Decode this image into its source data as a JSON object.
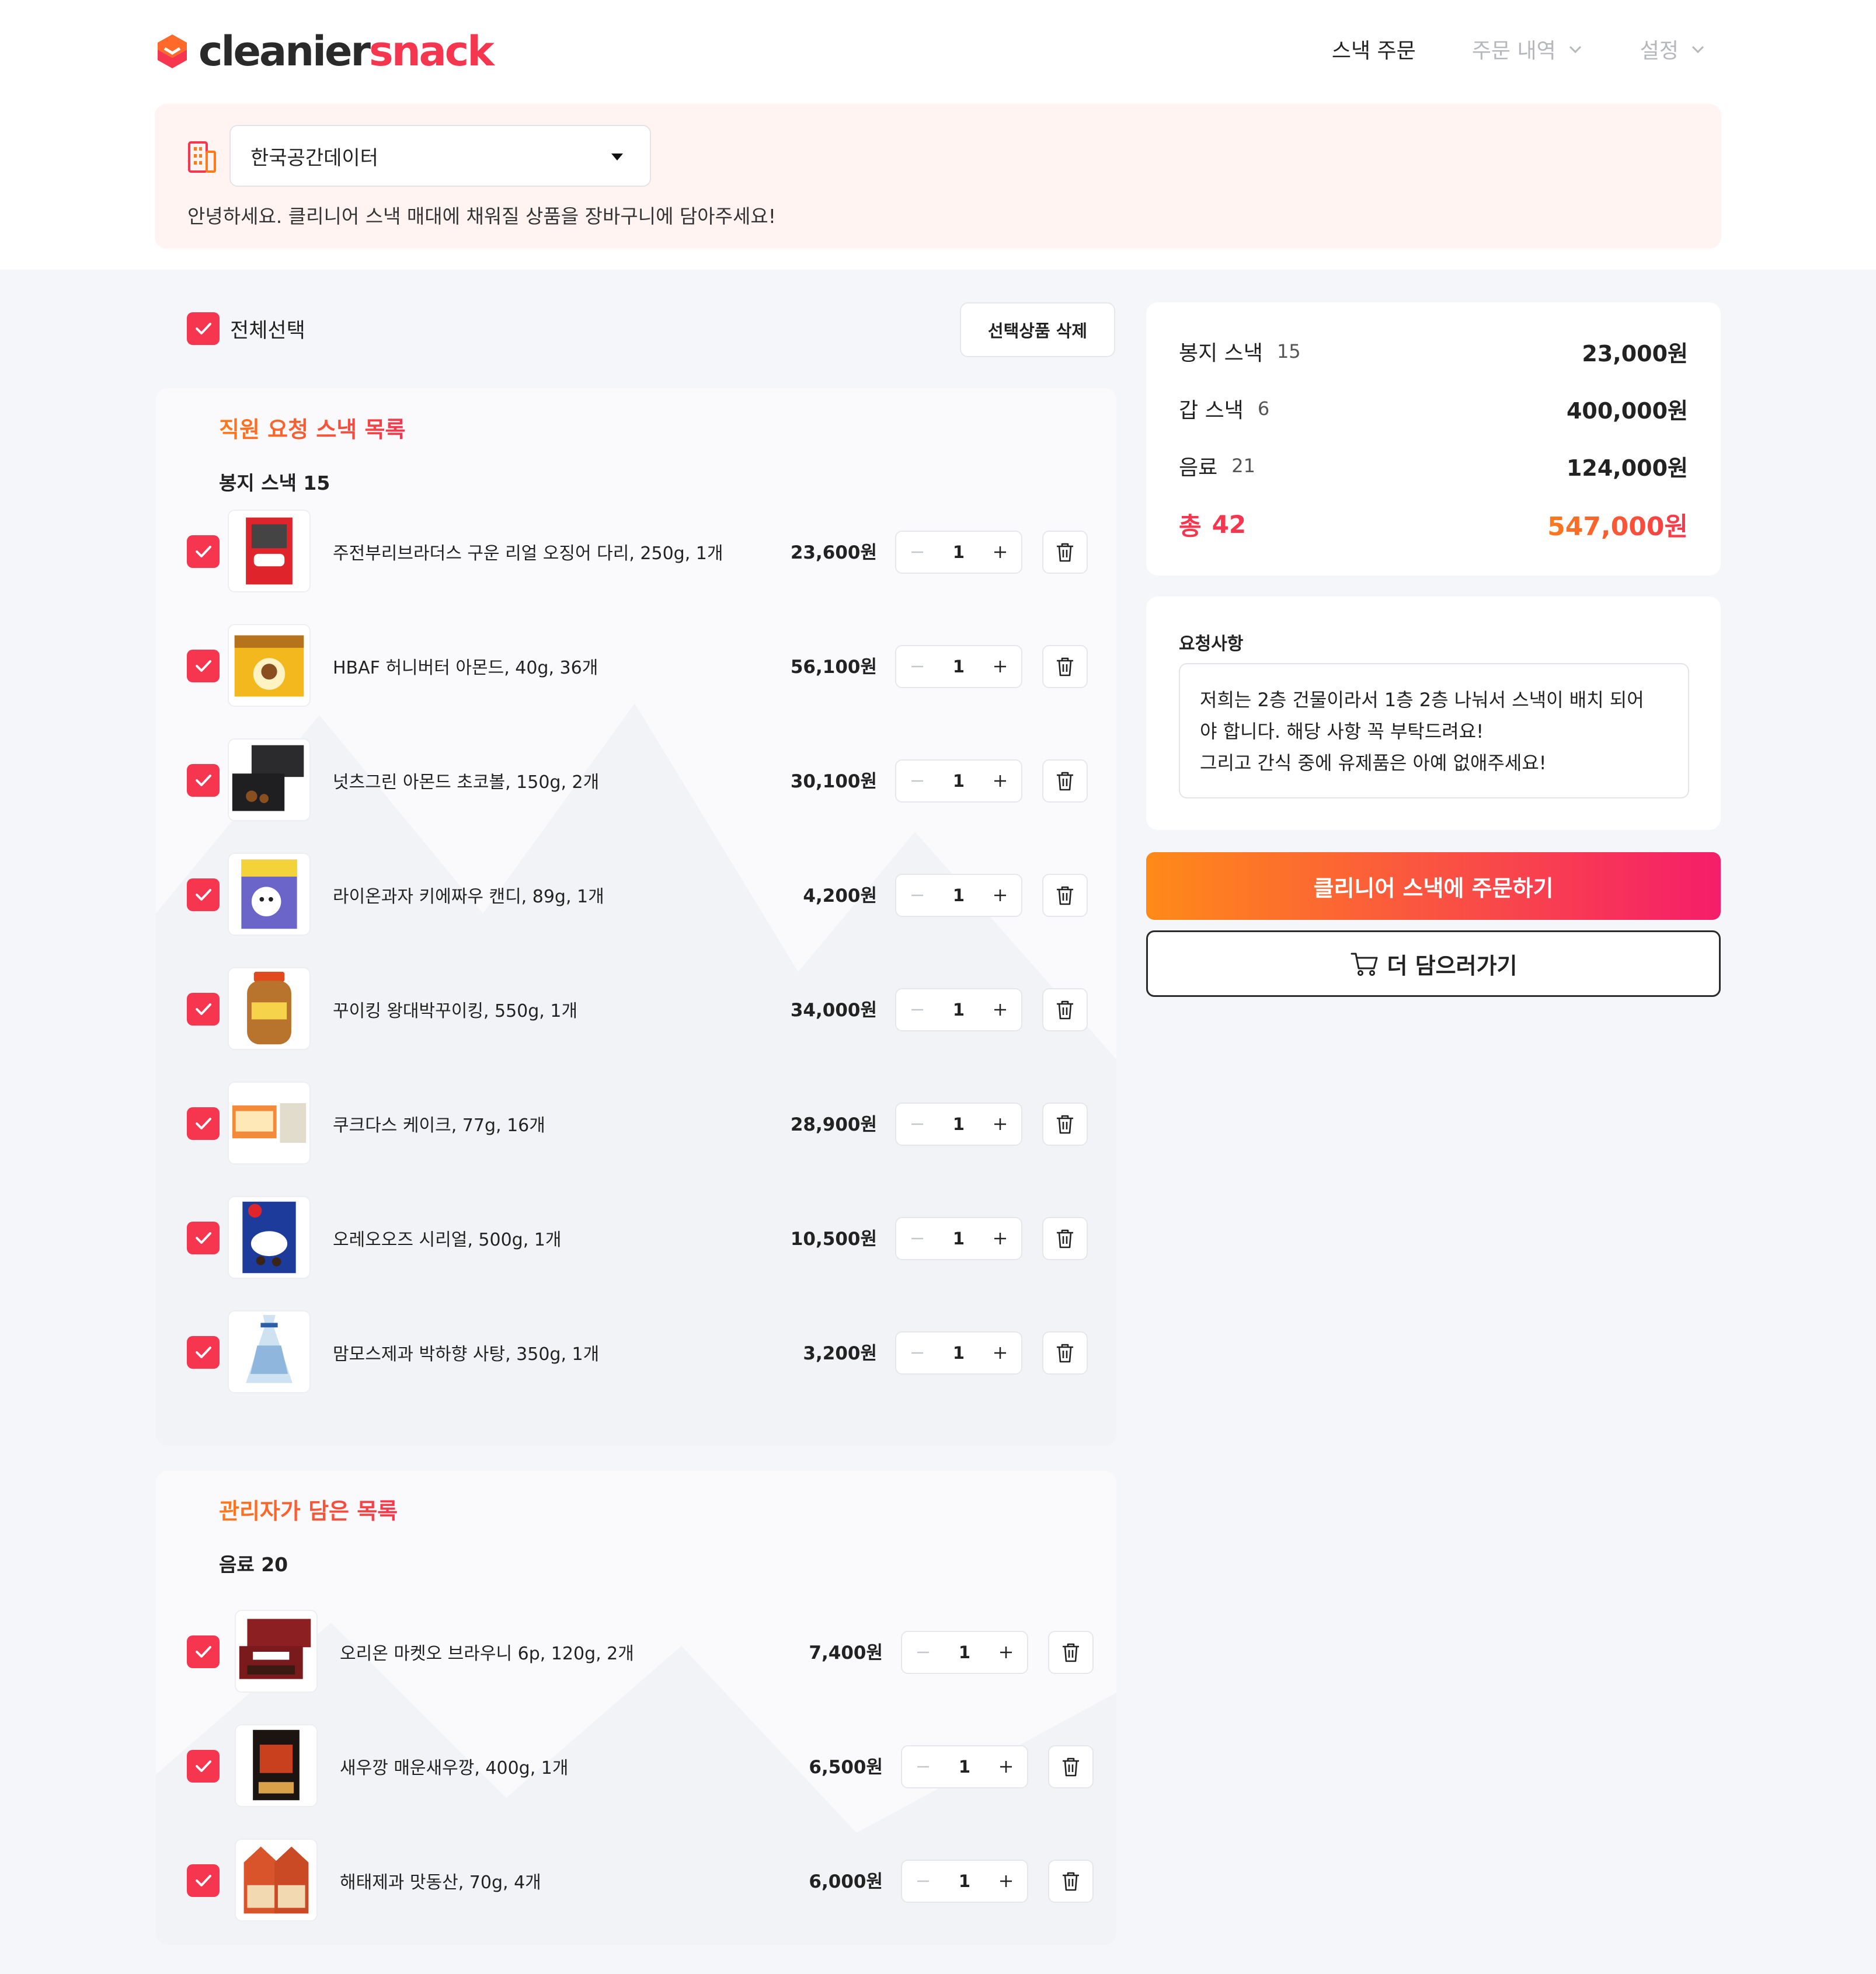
{
  "brand": {
    "part1": "cleanier",
    "part2": "snack"
  },
  "nav": [
    {
      "label": "스낵 주문",
      "active": true,
      "dropdown": false
    },
    {
      "label": "주문 내역",
      "active": false,
      "dropdown": true
    },
    {
      "label": "설정",
      "active": false,
      "dropdown": true
    }
  ],
  "banner": {
    "company": "한국공간데이터",
    "greeting": "안녕하세요. 클리니어 스낵 매대에 채워질 상품을 장바구니에 담아주세요!"
  },
  "list": {
    "select_all_label": "전체선택",
    "delete_selected_label": "선택상품 삭제"
  },
  "sections": [
    {
      "title": "직원 요청 스낵 목록",
      "group": "봉지 스낵 15",
      "items": [
        {
          "name": "주전부리브라더스 구운 리얼 오징어 다리, 250g, 1개",
          "price": "23,600원",
          "qty": "1",
          "icon": "squid-snack"
        },
        {
          "name": "HBAF 허니버터 아몬드, 40g, 36개",
          "price": "56,100원",
          "qty": "1",
          "icon": "almond-pack"
        },
        {
          "name": "넛츠그린 아몬드 초코볼, 150g, 2개",
          "price": "30,100원",
          "qty": "1",
          "icon": "choco-box"
        },
        {
          "name": "라이온과자 키에짜우 캔디, 89g, 1개",
          "price": "4,200원",
          "qty": "1",
          "icon": "candy-bag"
        },
        {
          "name": "꾸이킹 왕대박꾸이킹, 550g, 1개",
          "price": "34,000원",
          "qty": "1",
          "icon": "jar-snack"
        },
        {
          "name": "쿠크다스 케이크, 77g, 16개",
          "price": "28,900원",
          "qty": "1",
          "icon": "cake-box"
        },
        {
          "name": "오레오오즈 시리얼, 500g, 1개",
          "price": "10,500원",
          "qty": "1",
          "icon": "cereal-bag"
        },
        {
          "name": "맘모스제과 박하향 사탕, 350g, 1개",
          "price": "3,200원",
          "qty": "1",
          "icon": "mint-candy-bag"
        }
      ]
    },
    {
      "title": "관리자가 담은 목록",
      "group": "음료 20",
      "items": [
        {
          "name": "오리온 마켓오 브라우니 6p, 120g, 2개",
          "price": "7,400원",
          "qty": "1",
          "icon": "brownie-box"
        },
        {
          "name": "새우깡 매운새우깡, 400g, 1개",
          "price": "6,500원",
          "qty": "1",
          "icon": "shrimp-snack"
        },
        {
          "name": "해태제과 맛동산, 70g, 4개",
          "price": "6,000원",
          "qty": "1",
          "icon": "matdongsan-pack"
        }
      ]
    }
  ],
  "summary": {
    "rows": [
      {
        "label": "봉지 스낵",
        "count": "15",
        "amount": "23,000원"
      },
      {
        "label": "갑 스낵",
        "count": "6",
        "amount": "400,000원"
      },
      {
        "label": "음료",
        "count": "21",
        "amount": "124,000원"
      }
    ],
    "total": {
      "label": "총",
      "count": "42",
      "amount": "547,000원"
    }
  },
  "request": {
    "title": "요청사항",
    "text": "저희는 2층 건물이라서 1층 2층 나눠서 스낵이 배치 되어\n야 합니다. 해당 사항 꼭 부탁드려요!\n그리고 간식 중에 유제품은 아예 없애주세요!"
  },
  "actions": {
    "order_label": "클리니어 스낵에 주문하기",
    "more_label": "더 담으러가기"
  },
  "colors": {
    "accent": "#f5364e",
    "gradient_start": "#ff8a18",
    "gradient_end": "#f51d6a",
    "banner_bg": "#fff4f2"
  }
}
